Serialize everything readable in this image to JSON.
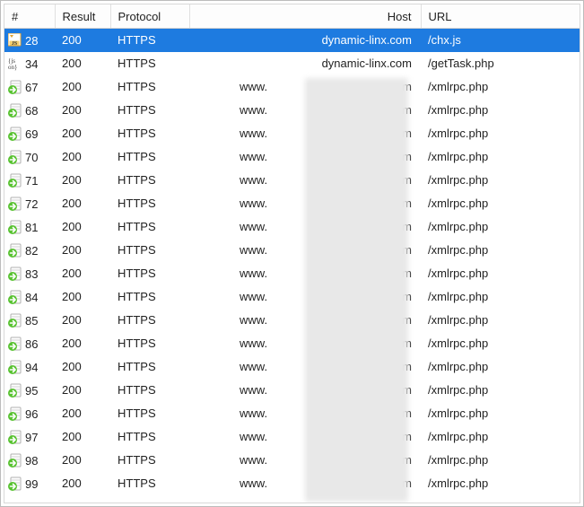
{
  "columns": {
    "num": "#",
    "result": "Result",
    "protocol": "Protocol",
    "host": "Host",
    "url": "URL"
  },
  "rows": [
    {
      "icon": "js-box",
      "num": "28",
      "result": "200",
      "protocol": "HTTPS",
      "host_prefix": "",
      "host_redacted": false,
      "host_suffix": "dynamic-linx.com",
      "url": "/chx.js",
      "selected": true
    },
    {
      "icon": "json-cn",
      "num": "34",
      "result": "200",
      "protocol": "HTTPS",
      "host_prefix": "",
      "host_redacted": false,
      "host_suffix": "dynamic-linx.com",
      "url": "/getTask.php",
      "selected": false
    },
    {
      "icon": "go-doc",
      "num": "67",
      "result": "200",
      "protocol": "HTTPS",
      "host_prefix": "www.",
      "host_redacted": true,
      "host_suffix": "com",
      "url": "/xmlrpc.php",
      "selected": false
    },
    {
      "icon": "go-doc",
      "num": "68",
      "result": "200",
      "protocol": "HTTPS",
      "host_prefix": "www.",
      "host_redacted": true,
      "host_suffix": "com",
      "url": "/xmlrpc.php",
      "selected": false
    },
    {
      "icon": "go-doc",
      "num": "69",
      "result": "200",
      "protocol": "HTTPS",
      "host_prefix": "www.",
      "host_redacted": true,
      "host_suffix": "com",
      "url": "/xmlrpc.php",
      "selected": false
    },
    {
      "icon": "go-doc",
      "num": "70",
      "result": "200",
      "protocol": "HTTPS",
      "host_prefix": "www.",
      "host_redacted": true,
      "host_suffix": "com",
      "url": "/xmlrpc.php",
      "selected": false
    },
    {
      "icon": "go-doc",
      "num": "71",
      "result": "200",
      "protocol": "HTTPS",
      "host_prefix": "www.",
      "host_redacted": true,
      "host_suffix": "com",
      "url": "/xmlrpc.php",
      "selected": false
    },
    {
      "icon": "go-doc",
      "num": "72",
      "result": "200",
      "protocol": "HTTPS",
      "host_prefix": "www.",
      "host_redacted": true,
      "host_suffix": "com",
      "url": "/xmlrpc.php",
      "selected": false
    },
    {
      "icon": "go-doc",
      "num": "81",
      "result": "200",
      "protocol": "HTTPS",
      "host_prefix": "www.",
      "host_redacted": true,
      "host_suffix": "com",
      "url": "/xmlrpc.php",
      "selected": false
    },
    {
      "icon": "go-doc",
      "num": "82",
      "result": "200",
      "protocol": "HTTPS",
      "host_prefix": "www.",
      "host_redacted": true,
      "host_suffix": "com",
      "url": "/xmlrpc.php",
      "selected": false
    },
    {
      "icon": "go-doc",
      "num": "83",
      "result": "200",
      "protocol": "HTTPS",
      "host_prefix": "www.",
      "host_redacted": true,
      "host_suffix": "com",
      "url": "/xmlrpc.php",
      "selected": false
    },
    {
      "icon": "go-doc",
      "num": "84",
      "result": "200",
      "protocol": "HTTPS",
      "host_prefix": "www.",
      "host_redacted": true,
      "host_suffix": "com",
      "url": "/xmlrpc.php",
      "selected": false
    },
    {
      "icon": "go-doc",
      "num": "85",
      "result": "200",
      "protocol": "HTTPS",
      "host_prefix": "www.",
      "host_redacted": true,
      "host_suffix": "com",
      "url": "/xmlrpc.php",
      "selected": false
    },
    {
      "icon": "go-doc",
      "num": "86",
      "result": "200",
      "protocol": "HTTPS",
      "host_prefix": "www.",
      "host_redacted": true,
      "host_suffix": "com",
      "url": "/xmlrpc.php",
      "selected": false
    },
    {
      "icon": "go-doc",
      "num": "94",
      "result": "200",
      "protocol": "HTTPS",
      "host_prefix": "www.",
      "host_redacted": true,
      "host_suffix": "com",
      "url": "/xmlrpc.php",
      "selected": false
    },
    {
      "icon": "go-doc",
      "num": "95",
      "result": "200",
      "protocol": "HTTPS",
      "host_prefix": "www.",
      "host_redacted": true,
      "host_suffix": "com",
      "url": "/xmlrpc.php",
      "selected": false
    },
    {
      "icon": "go-doc",
      "num": "96",
      "result": "200",
      "protocol": "HTTPS",
      "host_prefix": "www.",
      "host_redacted": true,
      "host_suffix": "com",
      "url": "/xmlrpc.php",
      "selected": false
    },
    {
      "icon": "go-doc",
      "num": "97",
      "result": "200",
      "protocol": "HTTPS",
      "host_prefix": "www.",
      "host_redacted": true,
      "host_suffix": "com",
      "url": "/xmlrpc.php",
      "selected": false
    },
    {
      "icon": "go-doc",
      "num": "98",
      "result": "200",
      "protocol": "HTTPS",
      "host_prefix": "www.",
      "host_redacted": true,
      "host_suffix": "com",
      "url": "/xmlrpc.php",
      "selected": false
    },
    {
      "icon": "go-doc",
      "num": "99",
      "result": "200",
      "protocol": "HTTPS",
      "host_prefix": "www.",
      "host_redacted": true,
      "host_suffix": "com",
      "url": "/xmlrpc.php",
      "selected": false
    }
  ]
}
